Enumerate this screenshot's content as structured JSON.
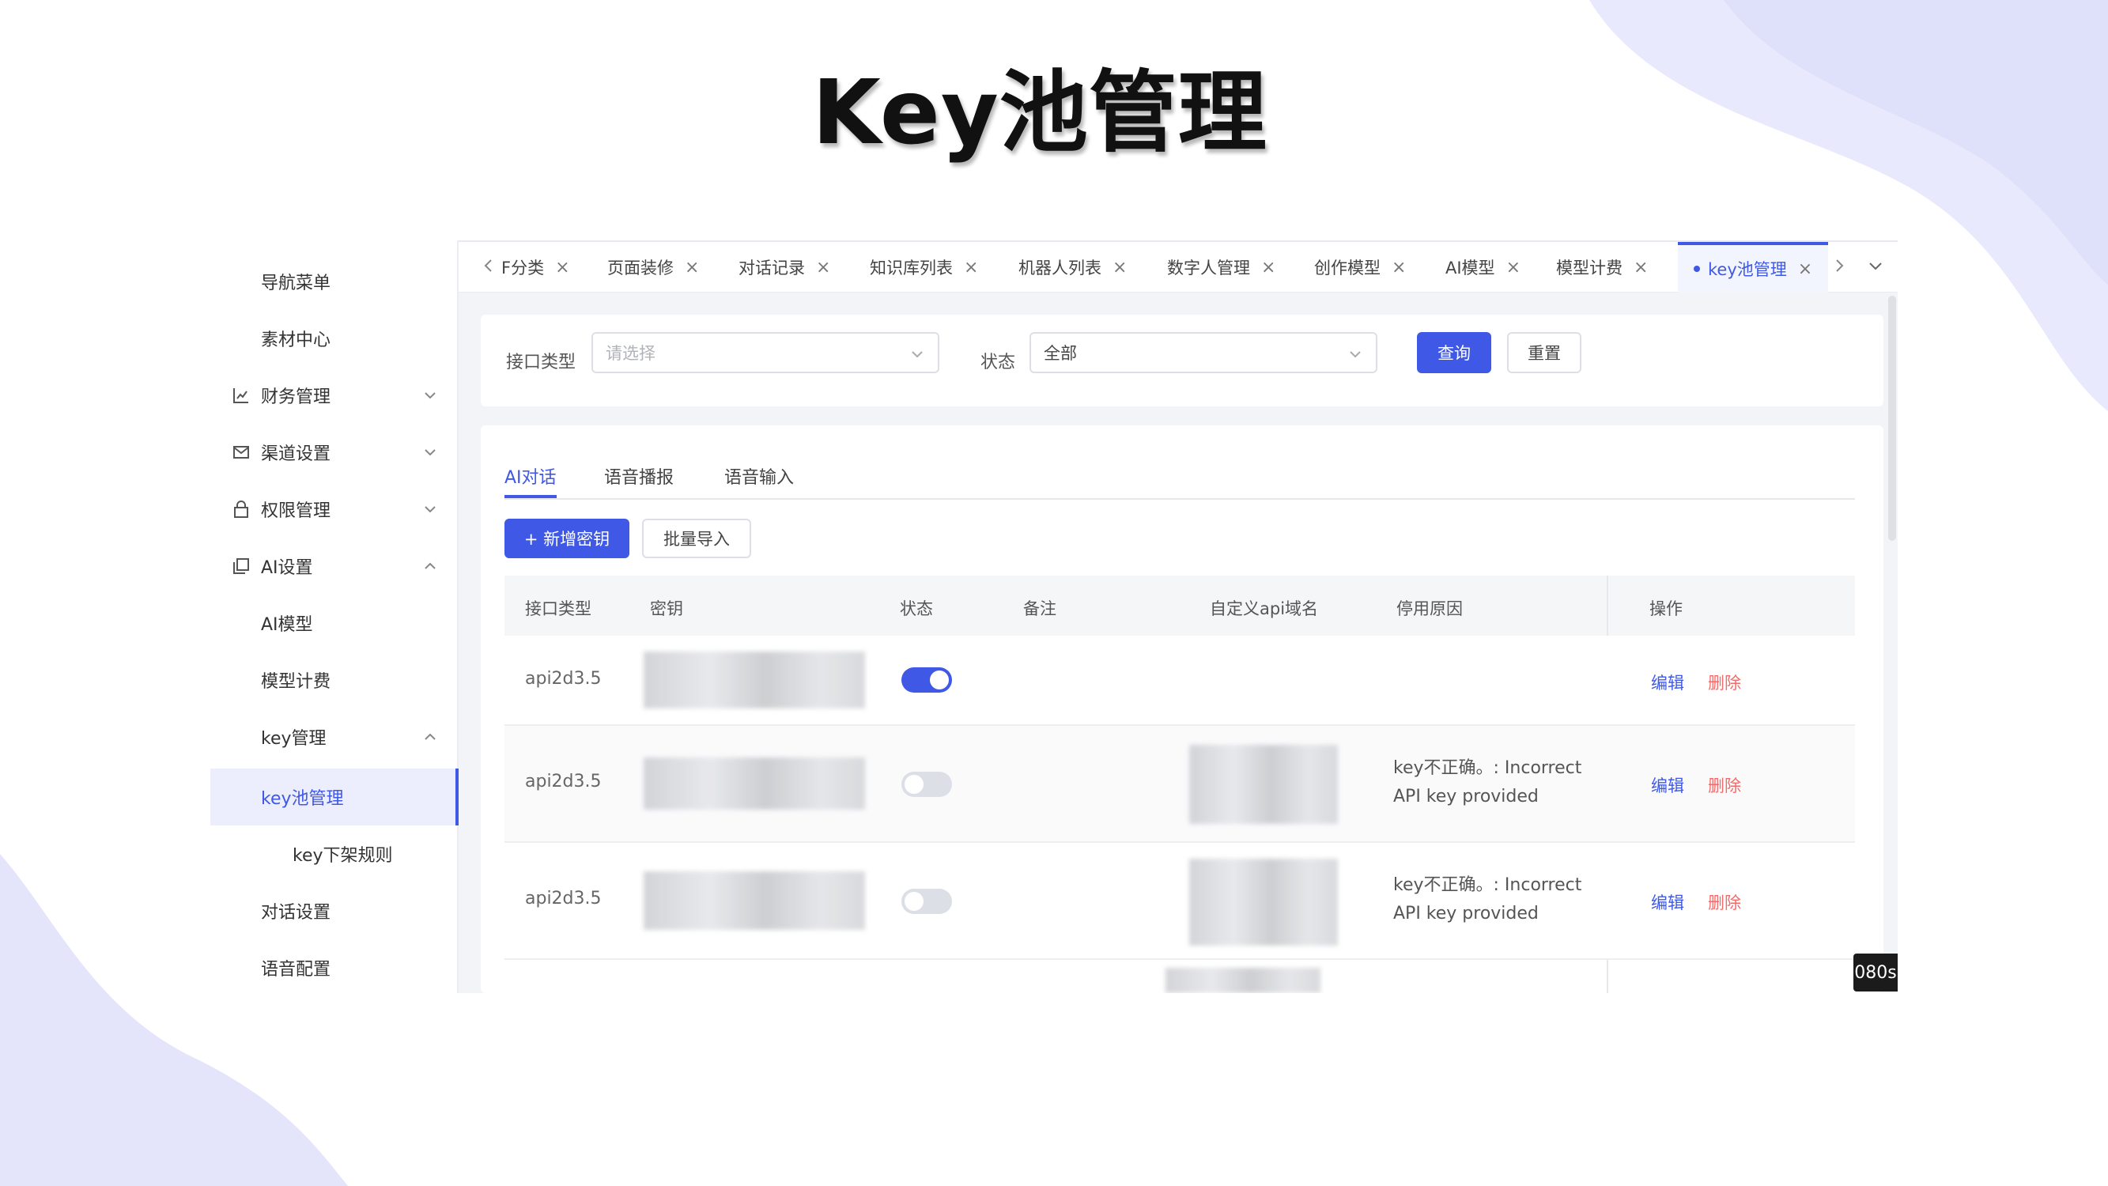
{
  "slide": {
    "title": "Key池管理"
  },
  "sidebar": {
    "items": [
      {
        "label": "导航菜单"
      },
      {
        "label": "素材中心"
      },
      {
        "label": "财务管理"
      },
      {
        "label": "渠道设置"
      },
      {
        "label": "权限管理"
      },
      {
        "label": "AI设置"
      },
      {
        "label": "AI模型"
      },
      {
        "label": "模型计费"
      },
      {
        "label": "key管理"
      },
      {
        "label": "key池管理"
      },
      {
        "label": "key下架规则"
      },
      {
        "label": "对话设置"
      },
      {
        "label": "语音配置"
      }
    ]
  },
  "tabs": [
    {
      "label": "F分类"
    },
    {
      "label": "页面装修"
    },
    {
      "label": "对话记录"
    },
    {
      "label": "知识库列表"
    },
    {
      "label": "机器人列表"
    },
    {
      "label": "数字人管理"
    },
    {
      "label": "创作模型"
    },
    {
      "label": "AI模型"
    },
    {
      "label": "模型计费"
    },
    {
      "label": "key池管理"
    }
  ],
  "tab_close": "×",
  "filter": {
    "type_label": "接口类型",
    "type_placeholder": "请选择",
    "status_label": "状态",
    "status_value": "全部",
    "query_button": "查询",
    "reset_button": "重置"
  },
  "content_tabs": [
    "AI对话",
    "语音播报",
    "语音输入"
  ],
  "actions": {
    "add_key": "+ 新增密钥",
    "batch_import": "批量导入"
  },
  "table": {
    "columns": [
      "接口类型",
      "密钥",
      "状态",
      "备注",
      "自定义api域名",
      "停用原因",
      "操作"
    ],
    "rows": [
      {
        "type": "api2d3.5",
        "enabled": true,
        "reason": ""
      },
      {
        "type": "api2d3.5",
        "enabled": false,
        "reason": "key不正确。: Incorrect API key provided"
      },
      {
        "type": "api2d3.5",
        "enabled": false,
        "reason": "key不正确。: Incorrect API key provided"
      }
    ],
    "edit_label": "编辑",
    "delete_label": "删除"
  },
  "timer_badge": "080s",
  "colors": {
    "primary": "#3f58e6",
    "danger": "#f26b6b",
    "background_blob": "#e6e7fb"
  }
}
